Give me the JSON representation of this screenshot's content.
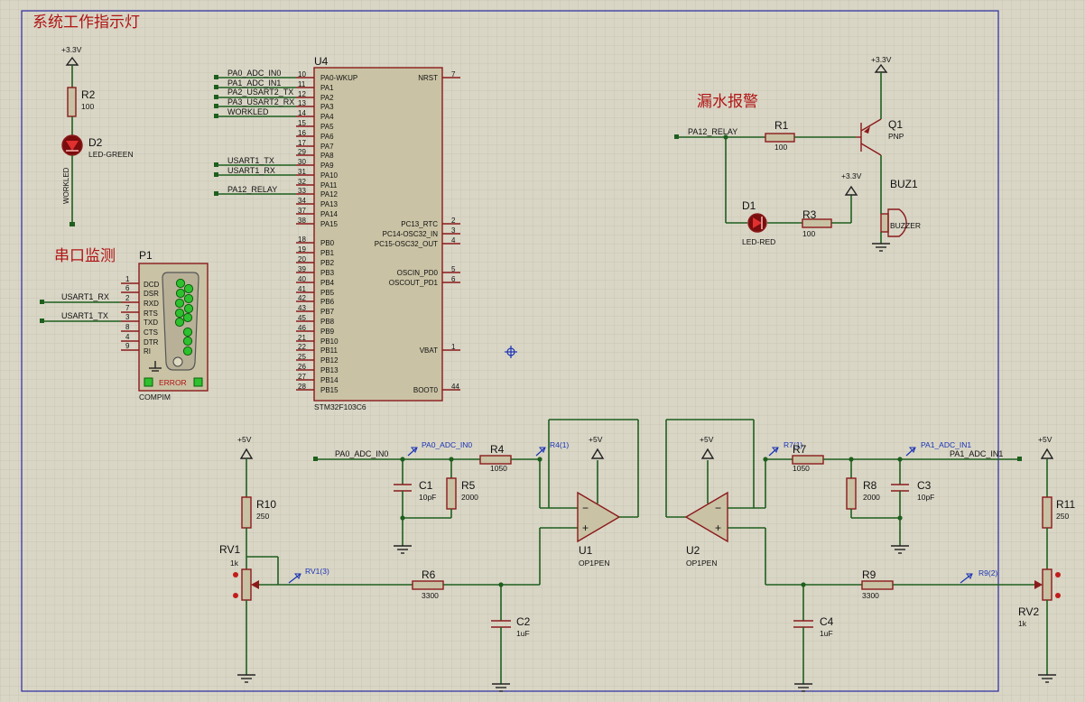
{
  "section_titles": {
    "led_indicator": "系统工作指示灯",
    "serial_monitor": "串口监测",
    "leak_alarm": "漏水报警"
  },
  "mcu": {
    "ref": "U4",
    "part": "STM32F103C6",
    "left_pins": [
      {
        "num": "10",
        "name": "PA0-WKUP"
      },
      {
        "num": "11",
        "name": "PA1"
      },
      {
        "num": "12",
        "name": "PA2"
      },
      {
        "num": "13",
        "name": "PA3"
      },
      {
        "num": "14",
        "name": "PA4"
      },
      {
        "num": "15",
        "name": "PA5"
      },
      {
        "num": "16",
        "name": "PA6"
      },
      {
        "num": "17",
        "name": "PA7"
      },
      {
        "num": "29",
        "name": "PA8"
      },
      {
        "num": "30",
        "name": "PA9"
      },
      {
        "num": "31",
        "name": "PA10"
      },
      {
        "num": "32",
        "name": "PA11"
      },
      {
        "num": "33",
        "name": "PA12"
      },
      {
        "num": "34",
        "name": "PA13"
      },
      {
        "num": "37",
        "name": "PA14"
      },
      {
        "num": "38",
        "name": "PA15"
      },
      {
        "num": "18",
        "name": "PB0"
      },
      {
        "num": "19",
        "name": "PB1"
      },
      {
        "num": "20",
        "name": "PB2"
      },
      {
        "num": "39",
        "name": "PB3"
      },
      {
        "num": "40",
        "name": "PB4"
      },
      {
        "num": "41",
        "name": "PB5"
      },
      {
        "num": "42",
        "name": "PB6"
      },
      {
        "num": "43",
        "name": "PB7"
      },
      {
        "num": "45",
        "name": "PB8"
      },
      {
        "num": "46",
        "name": "PB9"
      },
      {
        "num": "21",
        "name": "PB10"
      },
      {
        "num": "22",
        "name": "PB11"
      },
      {
        "num": "25",
        "name": "PB12"
      },
      {
        "num": "26",
        "name": "PB13"
      },
      {
        "num": "27",
        "name": "PB14"
      },
      {
        "num": "28",
        "name": "PB15"
      }
    ],
    "right_pins": [
      {
        "num": "7",
        "name": "NRST"
      },
      {
        "num": "2",
        "name": "PC13_RTC"
      },
      {
        "num": "3",
        "name": "PC14-OSC32_IN"
      },
      {
        "num": "4",
        "name": "PC15-OSC32_OUT"
      },
      {
        "num": "5",
        "name": "OSCIN_PD0"
      },
      {
        "num": "6",
        "name": "OSCOUT_PD1"
      },
      {
        "num": "1",
        "name": "VBAT"
      },
      {
        "num": "44",
        "name": "BOOT0"
      }
    ],
    "net_labels": [
      "PA0_ADC_IN0",
      "PA1_ADC_IN1",
      "PA2_USART2_TX",
      "PA3_USART2_RX",
      "WORKLED",
      "USART1_TX",
      "USART1_RX",
      "PA12_RELAY"
    ]
  },
  "serial_port": {
    "ref": "P1",
    "part": "COMPIM",
    "pins": [
      {
        "num": "1",
        "name": "DCD"
      },
      {
        "num": "6",
        "name": "DSR"
      },
      {
        "num": "2",
        "name": "RXD"
      },
      {
        "num": "7",
        "name": "RTS"
      },
      {
        "num": "3",
        "name": "TXD"
      },
      {
        "num": "8",
        "name": "CTS"
      },
      {
        "num": "4",
        "name": "DTR"
      },
      {
        "num": "9",
        "name": "RI"
      }
    ],
    "status": "ERROR",
    "net_rx": "USART1_RX",
    "net_tx": "USART1_TX"
  },
  "led_circuit": {
    "supply": "+3.3V",
    "resistor": {
      "ref": "R2",
      "value": "100"
    },
    "led": {
      "ref": "D2",
      "part": "LED-GREEN"
    },
    "net": "WORKLED"
  },
  "alarm_circuit": {
    "supply_q": "+3.3V",
    "supply_led": "+3.3V",
    "net": "PA12_RELAY",
    "r1": {
      "ref": "R1",
      "value": "100"
    },
    "q1": {
      "ref": "Q1",
      "part": "PNP"
    },
    "buzzer": {
      "ref": "BUZ1",
      "part": "BUZZER"
    },
    "d1": {
      "ref": "D1",
      "part": "LED-RED"
    },
    "r3": {
      "ref": "R3",
      "value": "100"
    }
  },
  "left_analog": {
    "supply_pot": "+5V",
    "supply_op": "+5V",
    "net": "PA0_ADC_IN0",
    "probe_net": "PA0_ADC_IN0",
    "probe_r4": "R4(1)",
    "probe_rv": "RV1(3)",
    "r10": {
      "ref": "R10",
      "value": "250"
    },
    "rv1": {
      "ref": "RV1",
      "value": "1k"
    },
    "r6": {
      "ref": "R6",
      "value": "3300"
    },
    "c2": {
      "ref": "C2",
      "value": "1uF"
    },
    "r4": {
      "ref": "R4",
      "value": "1050"
    },
    "c1": {
      "ref": "C1",
      "value": "10pF"
    },
    "r5": {
      "ref": "R5",
      "value": "2000"
    },
    "u1": {
      "ref": "U1",
      "part": "OP1PEN"
    }
  },
  "right_analog": {
    "supply_pot": "+5V",
    "supply_op": "+5V",
    "net": "PA1_ADC_IN1",
    "probe_net": "PA1_ADC_IN1",
    "probe_r7": "R7(1)",
    "probe_r9": "R9(2)",
    "r11": {
      "ref": "R11",
      "value": "250"
    },
    "rv2": {
      "ref": "RV2",
      "value": "1k"
    },
    "r9": {
      "ref": "R9",
      "value": "3300"
    },
    "c4": {
      "ref": "C4",
      "value": "1uF"
    },
    "r7": {
      "ref": "R7",
      "value": "1050"
    },
    "c3": {
      "ref": "C3",
      "value": "10pF"
    },
    "r8": {
      "ref": "R8",
      "value": "2000"
    },
    "u2": {
      "ref": "U2",
      "part": "OP1PEN"
    }
  },
  "colors": {
    "background": "#d9d6c6",
    "grid": "#c4c0ae",
    "wire": "#1e5f1e",
    "part": "#8b1a1a",
    "title": "#b01414",
    "probe": "#1a33b5",
    "border": "#2a2aa0"
  }
}
